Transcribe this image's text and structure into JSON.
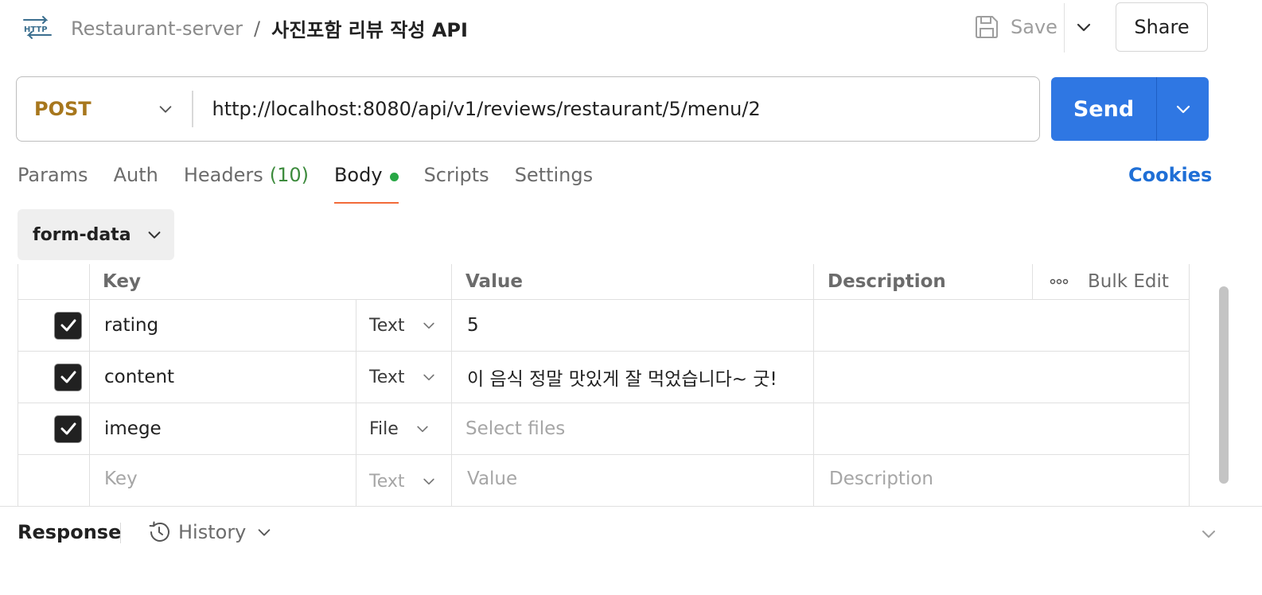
{
  "header": {
    "protocol_icon": "http-icon",
    "collection": "Restaurant-server",
    "separator": "/",
    "request_name": "사진포함 리뷰 작성 API",
    "save_label": "Save",
    "share_label": "Share"
  },
  "request": {
    "method": "POST",
    "url": "http://localhost:8080/api/v1/reviews/restaurant/5/menu/2",
    "send_label": "Send"
  },
  "tabs": [
    {
      "label": "Params"
    },
    {
      "label": "Auth"
    },
    {
      "label": "Headers",
      "count": "(10)"
    },
    {
      "label": "Body",
      "active": true,
      "has_dot": true
    },
    {
      "label": "Scripts"
    },
    {
      "label": "Settings"
    }
  ],
  "cookies_label": "Cookies",
  "body_type": "form-data",
  "table": {
    "headers": {
      "key": "Key",
      "value": "Value",
      "description": "Description",
      "bulk_edit": "Bulk Edit"
    },
    "rows": [
      {
        "checked": true,
        "key": "rating",
        "type": "Text",
        "value": "5",
        "description": ""
      },
      {
        "checked": true,
        "key": "content",
        "type": "Text",
        "value": "이 음식 정말 맛있게 잘 먹었습니다~ 굿!",
        "description": ""
      },
      {
        "checked": true,
        "key": "imege",
        "type": "File",
        "value": "",
        "value_placeholder": "Select files",
        "description": ""
      }
    ],
    "new_row": {
      "key_placeholder": "Key",
      "type": "Text",
      "value_placeholder": "Value",
      "description_placeholder": "Description"
    }
  },
  "response": {
    "label": "Response",
    "history_label": "History"
  },
  "colors": {
    "method_post": "#a7771d",
    "send_button": "#2f77e3",
    "active_tab_underline": "#f26b3a",
    "body_dot": "#28a745",
    "cookies_link": "#1f6fd6",
    "headers_count": "#3d8b3d"
  }
}
